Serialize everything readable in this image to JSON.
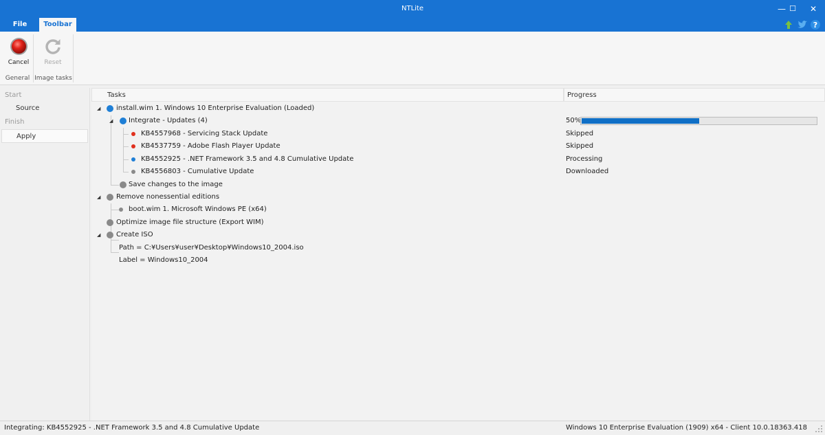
{
  "window": {
    "title": "NTLite"
  },
  "window_controls": {
    "minimize": "—",
    "maximize": "☐",
    "close": "✕"
  },
  "menu_tabs": [
    {
      "label": "File"
    },
    {
      "label": "Toolbar",
      "active": true
    }
  ],
  "title_icons": [
    "update-arrow-icon",
    "twitter-bird-icon",
    "help-icon"
  ],
  "ribbon": {
    "cancel_label": "Cancel",
    "reset_label": "Reset",
    "group_general": "General",
    "group_image_tasks": "Image tasks"
  },
  "left_nav": {
    "section_start": "Start",
    "item_source": "Source",
    "section_finish": "Finish",
    "item_apply": "Apply"
  },
  "columns": {
    "tasks": "Tasks",
    "progress": "Progress"
  },
  "tree": [
    {
      "text": "install.wim 1. Windows 10 Enterprise Evaluation  (Loaded)",
      "progress": ""
    },
    {
      "text": "Integrate - Updates (4)",
      "progress": "50%"
    },
    {
      "text": "KB4557968 - Servicing Stack Update",
      "progress": "Skipped"
    },
    {
      "text": "KB4537759 - Adobe Flash Player Update",
      "progress": "Skipped"
    },
    {
      "text": "KB4552925 - .NET Framework 3.5 and 4.8 Cumulative Update",
      "progress": "Processing"
    },
    {
      "text": "KB4556803 - Cumulative Update",
      "progress": "Downloaded"
    },
    {
      "text": "Save changes to the image",
      "progress": ""
    },
    {
      "text": "Remove nonessential editions",
      "progress": ""
    },
    {
      "text": "boot.wim 1. Microsoft Windows PE (x64)",
      "progress": ""
    },
    {
      "text": "Optimize image file structure (Export WIM)",
      "progress": ""
    },
    {
      "text": "Create ISO",
      "progress": ""
    },
    {
      "text": "Path = C:¥Users¥user¥Desktop¥Windows10_2004.iso",
      "progress": ""
    },
    {
      "text": "Label = Windows10_2004",
      "progress": ""
    }
  ],
  "integrate_progress_percent": 50,
  "colors": {
    "accent": "#1873d3",
    "status_blue": "#1f7fd6",
    "status_red": "#e0301e",
    "status_gray": "#8a8a8a",
    "progress_fill": "#0f6fc6"
  },
  "status_bar": {
    "left": "Integrating: KB4552925 - .NET Framework 3.5 and 4.8 Cumulative Update",
    "right": "Windows 10 Enterprise Evaluation (1909) x64 - Client 10.0.18363.418"
  }
}
